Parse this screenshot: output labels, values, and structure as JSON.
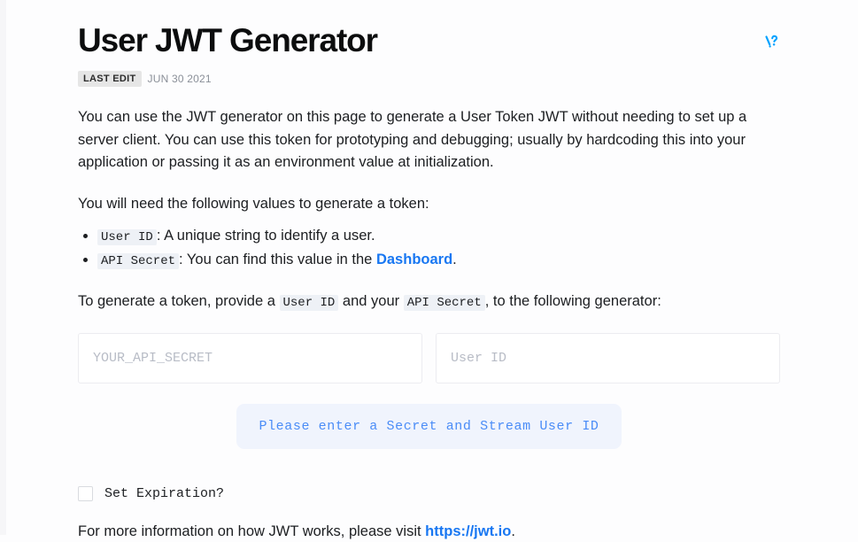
{
  "page": {
    "title": "User JWT Generator",
    "help_icon": "help-question-icon",
    "accent_color": "#1877f2",
    "notice_color": "#4a8cf7"
  },
  "meta": {
    "badge_label": "LAST EDIT",
    "date": "JUN 30 2021"
  },
  "intro": {
    "paragraph": "You can use the JWT generator on this page to generate a User Token JWT without needing to set up a server client. You can use this token for prototyping and debugging; usually by hardcoding this into your application or passing it as an environment value at initialization.",
    "values_lead": "You will need the following values to generate a token:"
  },
  "values_list": [
    {
      "code": "User ID",
      "separator": ":",
      "text": "A unique string to identify a user.",
      "link": null,
      "tail": null
    },
    {
      "code": "API Secret",
      "separator": ":",
      "text": "You can find this value in the",
      "link": "Dashboard",
      "tail": "."
    }
  ],
  "generator_lead": {
    "part1": "To generate a token, provide a",
    "code1": "User ID",
    "part2": "and your",
    "code2": "API Secret",
    "part3": ", to the following generator:"
  },
  "form": {
    "secret_input": {
      "value": "",
      "placeholder": "YOUR_API_SECRET"
    },
    "userid_input": {
      "value": "",
      "placeholder": "User ID"
    },
    "notice": "Please enter a Secret and Stream User ID",
    "expiration": {
      "label": "Set Expiration?",
      "checked": false
    }
  },
  "footer": {
    "text": "For more information on how JWT works, please visit",
    "link": "https://jwt.io",
    "tail": "."
  }
}
